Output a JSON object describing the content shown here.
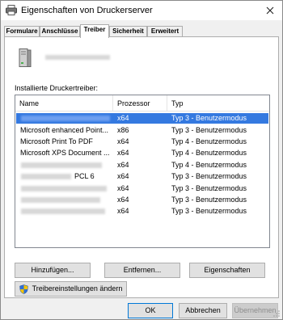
{
  "window": {
    "title": "Eigenschaften von Druckerserver"
  },
  "tabs": [
    {
      "label": "Formulare"
    },
    {
      "label": "Anschlüsse"
    },
    {
      "label": "Treiber",
      "active": true
    },
    {
      "label": "Sicherheit"
    },
    {
      "label": "Erweitert"
    }
  ],
  "drivers": {
    "label": "Installierte Druckertreiber:",
    "columns": [
      "Name",
      "Prozessor",
      "Typ"
    ],
    "rows": [
      {
        "name": "",
        "processor": "x64",
        "type": "Typ 3 - Benutzermodus",
        "selected": true,
        "redacted": true
      },
      {
        "name": "Microsoft enhanced Point...",
        "processor": "x86",
        "type": "Typ 3 - Benutzermodus"
      },
      {
        "name": "Microsoft Print To PDF",
        "processor": "x64",
        "type": "Typ 4 - Benutzermodus"
      },
      {
        "name": "Microsoft XPS Document ...",
        "processor": "x64",
        "type": "Typ 4 - Benutzermodus"
      },
      {
        "name": "",
        "processor": "x64",
        "type": "Typ 4 - Benutzermodus",
        "redacted": true
      },
      {
        "name": "PCL 6",
        "processor": "x64",
        "type": "Typ 3 - Benutzermodus",
        "redacted": true,
        "suffix": true
      },
      {
        "name": "",
        "processor": "x64",
        "type": "Typ 3 - Benutzermodus",
        "redacted": true
      },
      {
        "name": "",
        "processor": "x64",
        "type": "Typ 3 - Benutzermodus",
        "redacted": true
      },
      {
        "name": "",
        "processor": "x64",
        "type": "Typ 3 - Benutzermodus",
        "redacted": true
      }
    ]
  },
  "buttons": {
    "add": "Hinzufügen...",
    "remove": "Entfernen...",
    "properties": "Eigenschaften",
    "change_settings": "Treibereinstellungen ändern",
    "ok": "OK",
    "cancel": "Abbrechen",
    "apply": "Übernehmen"
  },
  "colors": {
    "selection": "#3479e0",
    "default_button_border": "#0078d7",
    "shield_blue": "#2f6fd6",
    "shield_yellow": "#f2c200"
  },
  "icons": {
    "title": "printer-icon",
    "close": "close-icon",
    "server": "server-icon",
    "shield": "uac-shield-icon"
  }
}
